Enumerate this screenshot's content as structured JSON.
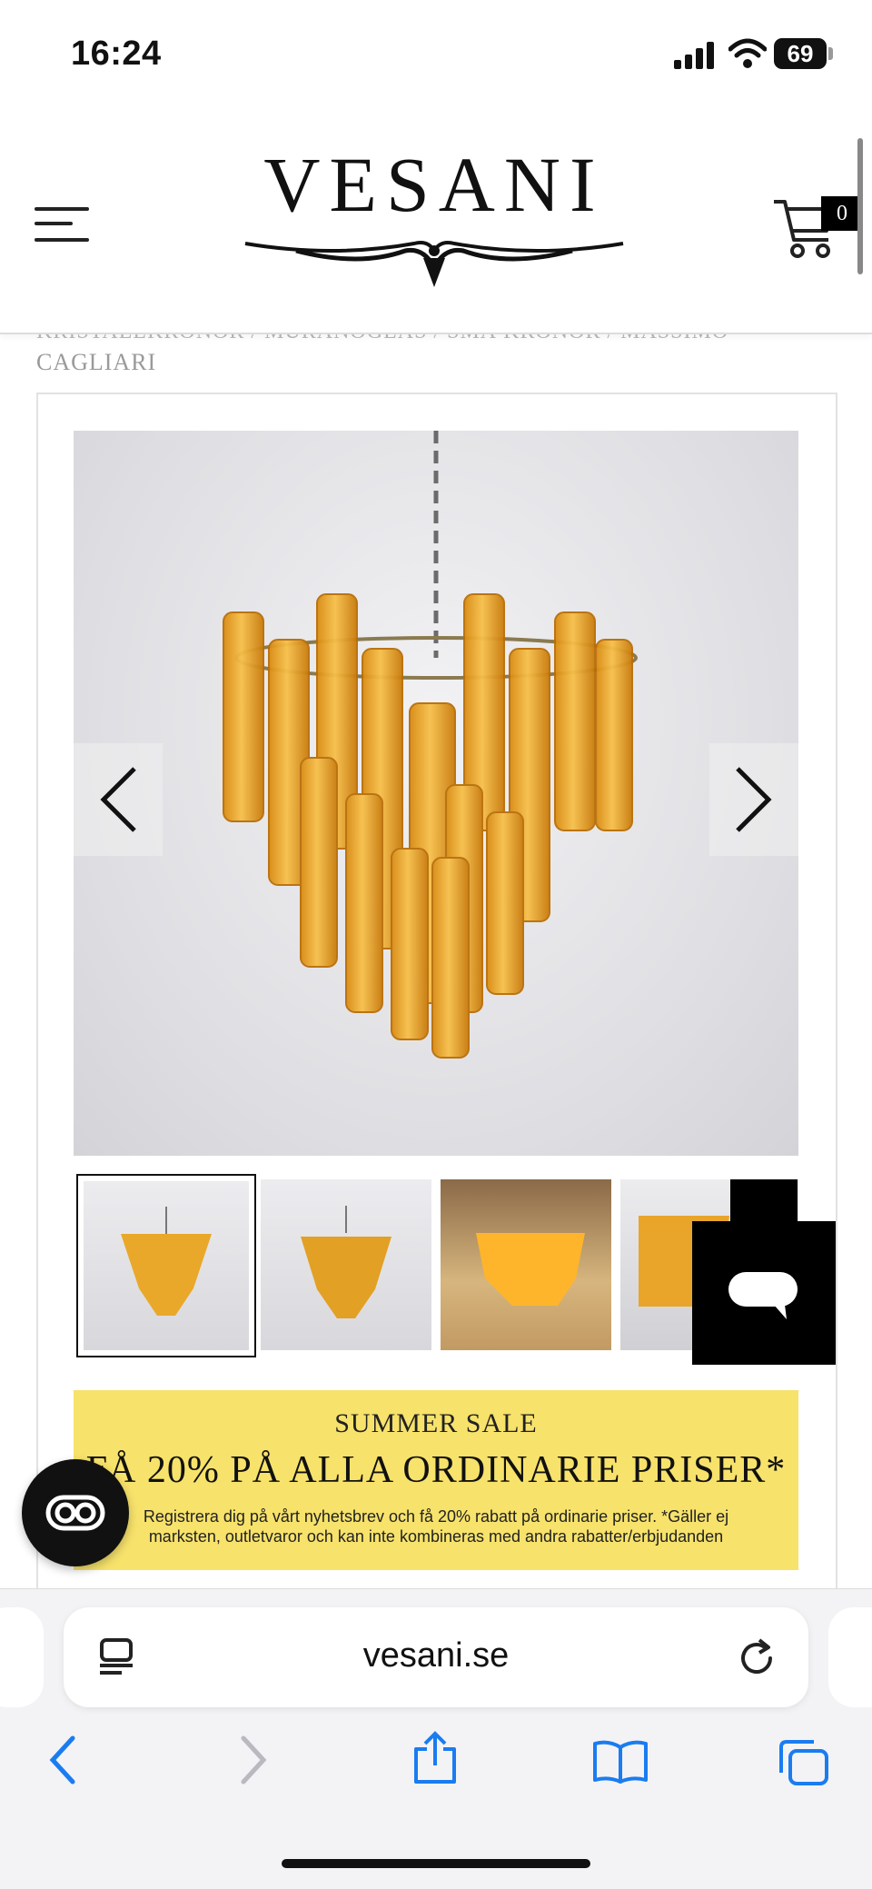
{
  "status_bar": {
    "time": "16:24",
    "battery": "69"
  },
  "header": {
    "logo_text": "VESANI",
    "cart_count": "0"
  },
  "breadcrumb": {
    "partial_line": "KRISTALLKRONOR / MURANOGLAS / SMÅ KRONOR / MASSIMO",
    "current": "CAGLIARI"
  },
  "product": {
    "image_alt": "Amber Murano glass tube chandelier",
    "thumbnails": [
      "thumb-studio-1",
      "thumb-studio-2",
      "thumb-interior",
      "thumb-studio-3"
    ]
  },
  "sale_banner": {
    "title": "SUMMER SALE",
    "headline": "FÅ 20% PÅ ALLA ORDINARIE PRISER*",
    "body": "Registrera dig på vårt nyhetsbrev och få 20% rabatt på ordinarie priser. *Gäller ej marksten, outletvaror och kan inte kombineras med andra rabatter/erbjudanden",
    "color": "#f7e26b"
  },
  "browser": {
    "url": "vesani.se"
  },
  "icons": {
    "menu": "menu-icon",
    "cart": "cart-icon",
    "prev": "chevron-left-icon",
    "next": "chevron-right-icon",
    "chat": "chat-icon",
    "reader": "reader-icon",
    "reload": "reload-icon",
    "back": "back-icon",
    "forward": "forward-icon",
    "share": "share-icon",
    "bookmarks": "bookmarks-icon",
    "tabs": "tabs-icon"
  },
  "colors": {
    "accent": "#1a7cf0",
    "text": "#111111"
  }
}
